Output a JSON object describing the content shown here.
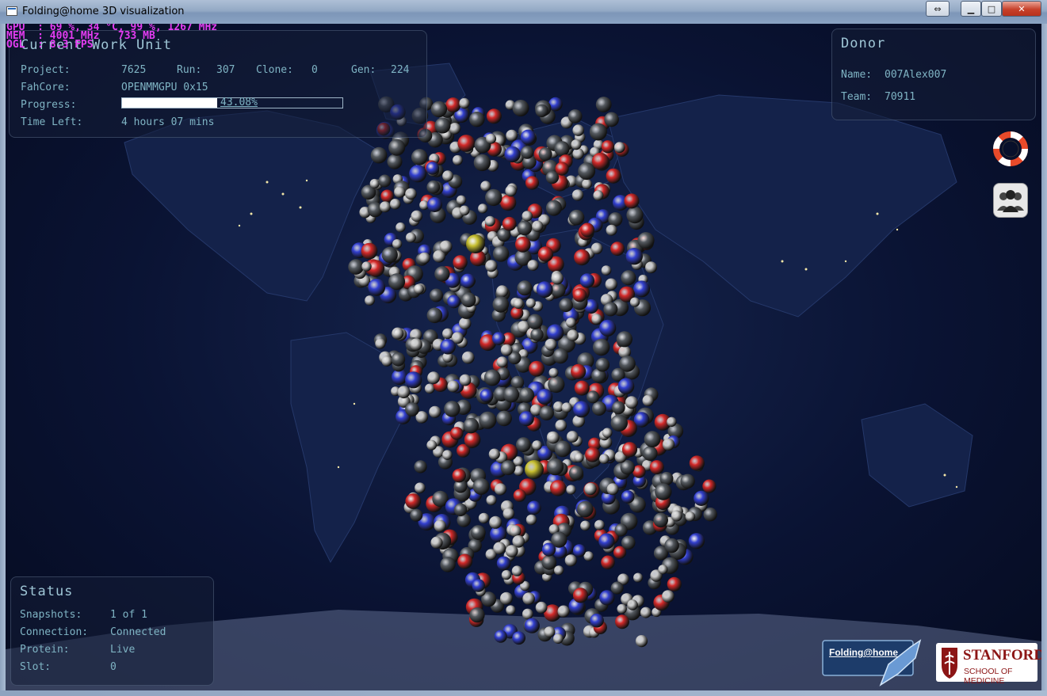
{
  "window": {
    "title": "Folding@home 3D visualization"
  },
  "gpu_overlay": {
    "line1": "GPU  : 69 %, 34 °C, 99 %, 1267 MHz",
    "line2": "MEM  : 4001 MHz   733 MB",
    "line3": "OGL  : 8.3 FPS"
  },
  "work_unit": {
    "title": "Current Work Unit",
    "project_label": "Project:",
    "project_value": "7625",
    "run_label": "Run:",
    "run_value": "307",
    "clone_label": "Clone:",
    "clone_value": "0",
    "gen_label": "Gen:",
    "gen_value": "224",
    "fahcore_label": "FahCore:",
    "fahcore_value": "OPENMMGPU 0x15",
    "progress_label": "Progress:",
    "progress_value": "43.08%",
    "progress_fraction": 0.4308,
    "time_left_label": "Time Left:",
    "time_left_value": "4 hours 07 mins"
  },
  "donor": {
    "title": "Donor",
    "name_label": "Name:",
    "name_value": "007Alex007",
    "team_label": "Team:",
    "team_value": "70911"
  },
  "status": {
    "title": "Status",
    "snapshots_label": "Snapshots:",
    "snapshots_value": "1 of 1",
    "connection_label": "Connection:",
    "connection_value": "Connected",
    "protein_label": "Protein:",
    "protein_value": "Live",
    "slot_label": "Slot:",
    "slot_value": "0"
  },
  "side_icons": [
    "lifebuoy-icon",
    "team-icon"
  ],
  "logos": {
    "fah": "Folding@home",
    "stanford_name": "STANFORD",
    "stanford_sub": "SCHOOL OF MEDICINE"
  },
  "colors": {
    "atom_carbon": "#555a60",
    "atom_hydrogen": "#c8c8c8",
    "atom_oxygen": "#d42a2a",
    "atom_nitrogen": "#3340d0",
    "atom_sulfur": "#c8c030",
    "panel_text": "#7fb4c4",
    "overlay_text": "#e23cf0",
    "stanford_red": "#8c1515"
  }
}
